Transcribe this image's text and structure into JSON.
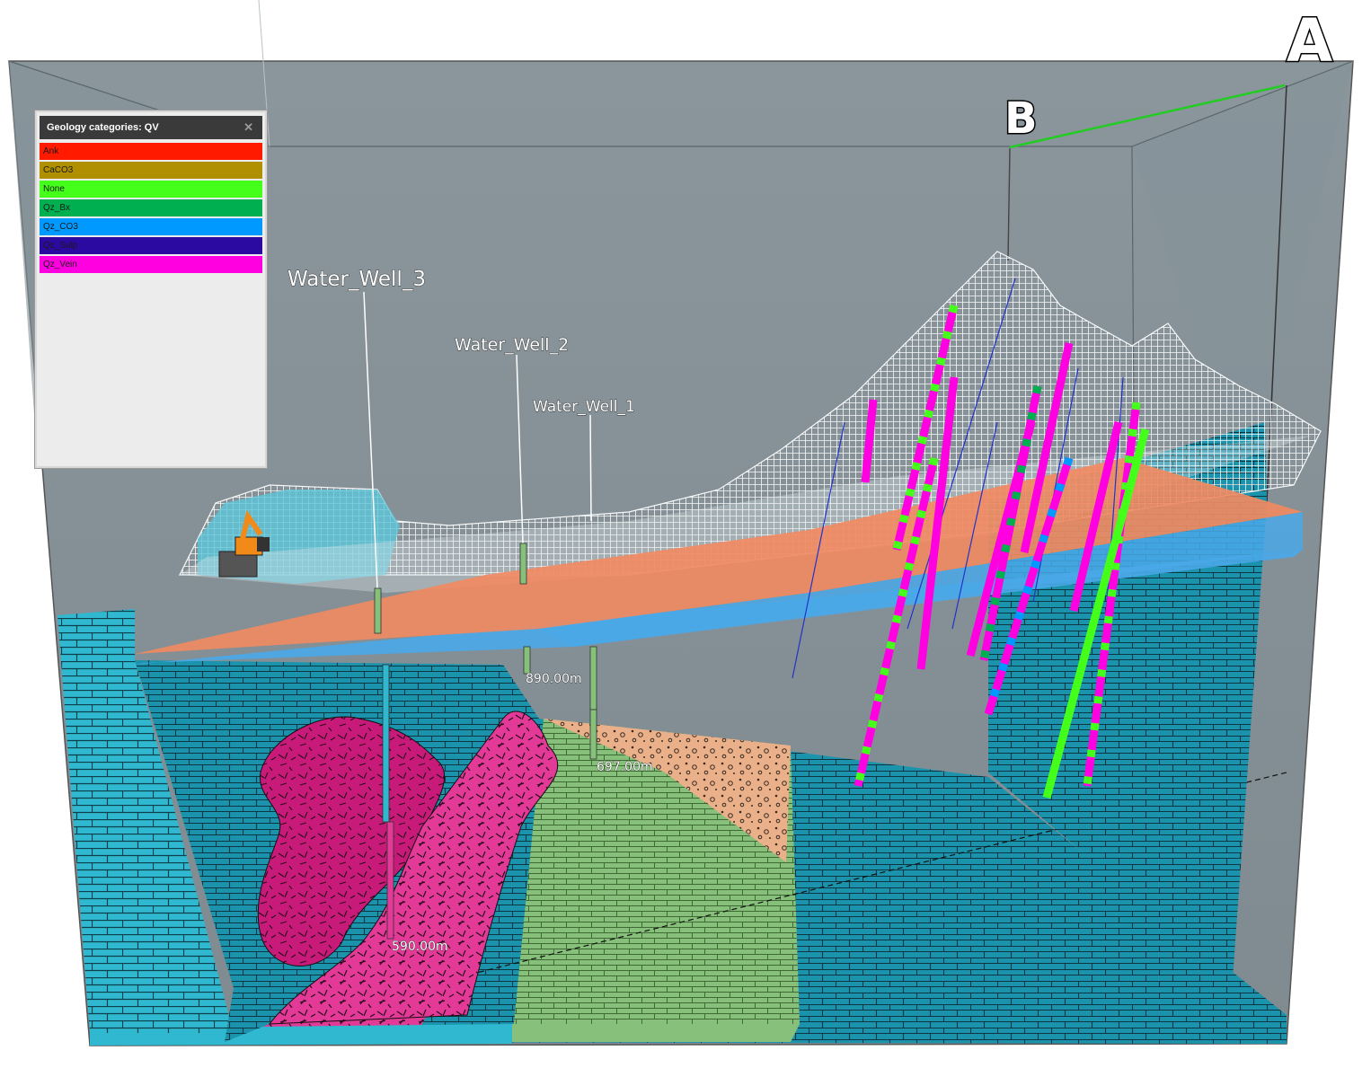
{
  "legend": {
    "title": "Geology categories: QV",
    "close_icon": "close-icon",
    "items": [
      {
        "label": "Ank",
        "color": "#ff1a00"
      },
      {
        "label": "CaCO3",
        "color": "#b09000"
      },
      {
        "label": "None",
        "color": "#44ff1a"
      },
      {
        "label": "Qz_Bx",
        "color": "#00b050"
      },
      {
        "label": "Qz_CO3",
        "color": "#0099ff"
      },
      {
        "label": "Qz_Sulp",
        "color": "#2a0aa0"
      },
      {
        "label": "Qz_Vein",
        "color": "#ff00e0"
      }
    ]
  },
  "wells": {
    "well3": {
      "name": "Water_Well_3",
      "depth": "590.00m"
    },
    "well2": {
      "name": "Water_Well_2",
      "depth": "890.00m"
    },
    "well1": {
      "name": "Water_Well_1",
      "depth": "697.00m"
    }
  },
  "corners": {
    "a": "A",
    "b": "B"
  },
  "colors": {
    "background_wall": "#8a9498",
    "limestone": "#2fb8cf",
    "limestone_dark": "#1e8ea8",
    "intrusive": "#e23a96",
    "sandstone_green": "#86c07a",
    "gravel": "#eab08a",
    "orange_surface": "#f08a62",
    "blue_surface": "#4aa8e8",
    "terrain_mesh": "#ffffff",
    "section_line": "#22cc22"
  }
}
